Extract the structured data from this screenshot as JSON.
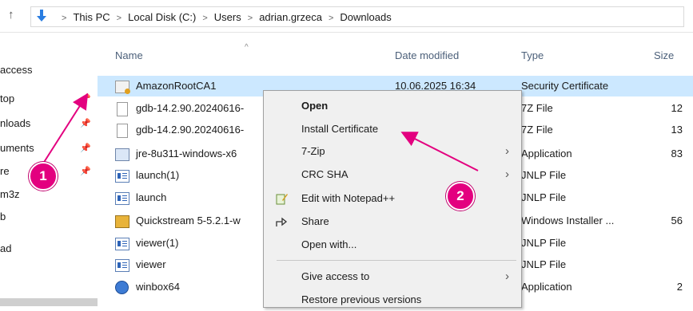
{
  "breadcrumbs": [
    "This PC",
    "Local Disk (C:)",
    "Users",
    "adrian.grzeca",
    "Downloads"
  ],
  "nav": {
    "items": [
      {
        "label": "access",
        "pinned": false
      },
      {
        "label": "top",
        "pinned": true
      },
      {
        "label": "nloads",
        "pinned": true
      },
      {
        "label": "uments",
        "pinned": true
      },
      {
        "label": "re",
        "pinned": true
      },
      {
        "label": "m3z",
        "pinned": false
      },
      {
        "label": "b",
        "pinned": false
      },
      {
        "label": "ad",
        "pinned": false
      }
    ],
    "pin_glyph": "📌"
  },
  "columns": {
    "name": "Name",
    "date": "Date modified",
    "type": "Type",
    "size": "Size"
  },
  "files": [
    {
      "name": "AmazonRootCA1",
      "date": "10.06.2025 16:34",
      "type": "Security Certificate",
      "size": "",
      "icon": "certificate-icon",
      "selected": true
    },
    {
      "name": "gdb-14.2.90.20240616-",
      "date": "",
      "type": "7Z File",
      "size": "12",
      "icon": "file-icon",
      "selected": false
    },
    {
      "name": "gdb-14.2.90.20240616-",
      "date": "",
      "type": "7Z File",
      "size": "13",
      "icon": "file-icon",
      "selected": false
    },
    {
      "name": "jre-8u311-windows-x6",
      "date": "",
      "type": "Application",
      "size": "83",
      "icon": "java-installer-icon",
      "selected": false
    },
    {
      "name": "launch(1)",
      "date": "",
      "type": "JNLP File",
      "size": "",
      "icon": "jnlp-file-icon",
      "selected": false
    },
    {
      "name": "launch",
      "date": "",
      "type": "JNLP File",
      "size": "",
      "icon": "jnlp-file-icon",
      "selected": false
    },
    {
      "name": "Quickstream 5-5.2.1-w",
      "date": "",
      "type": "Windows Installer ...",
      "size": "56",
      "icon": "msi-installer-icon",
      "selected": false
    },
    {
      "name": "viewer(1)",
      "date": "",
      "type": "JNLP File",
      "size": "",
      "icon": "jnlp-file-icon",
      "selected": false
    },
    {
      "name": "viewer",
      "date": "",
      "type": "JNLP File",
      "size": "",
      "icon": "jnlp-file-icon",
      "selected": false
    },
    {
      "name": "winbox64",
      "date": "",
      "type": "Application",
      "size": "2",
      "icon": "winbox-icon",
      "selected": false
    }
  ],
  "context_menu": {
    "open": "Open",
    "install_certificate": "Install Certificate",
    "seven_zip": "7-Zip",
    "crc_sha": "CRC SHA",
    "edit_notepad": "Edit with Notepad++",
    "share": "Share",
    "open_with": "Open with...",
    "give_access": "Give access to",
    "restore_versions": "Restore previous versions"
  },
  "annotations": {
    "badge1": "1",
    "badge2": "2",
    "color": "#e3007f"
  }
}
